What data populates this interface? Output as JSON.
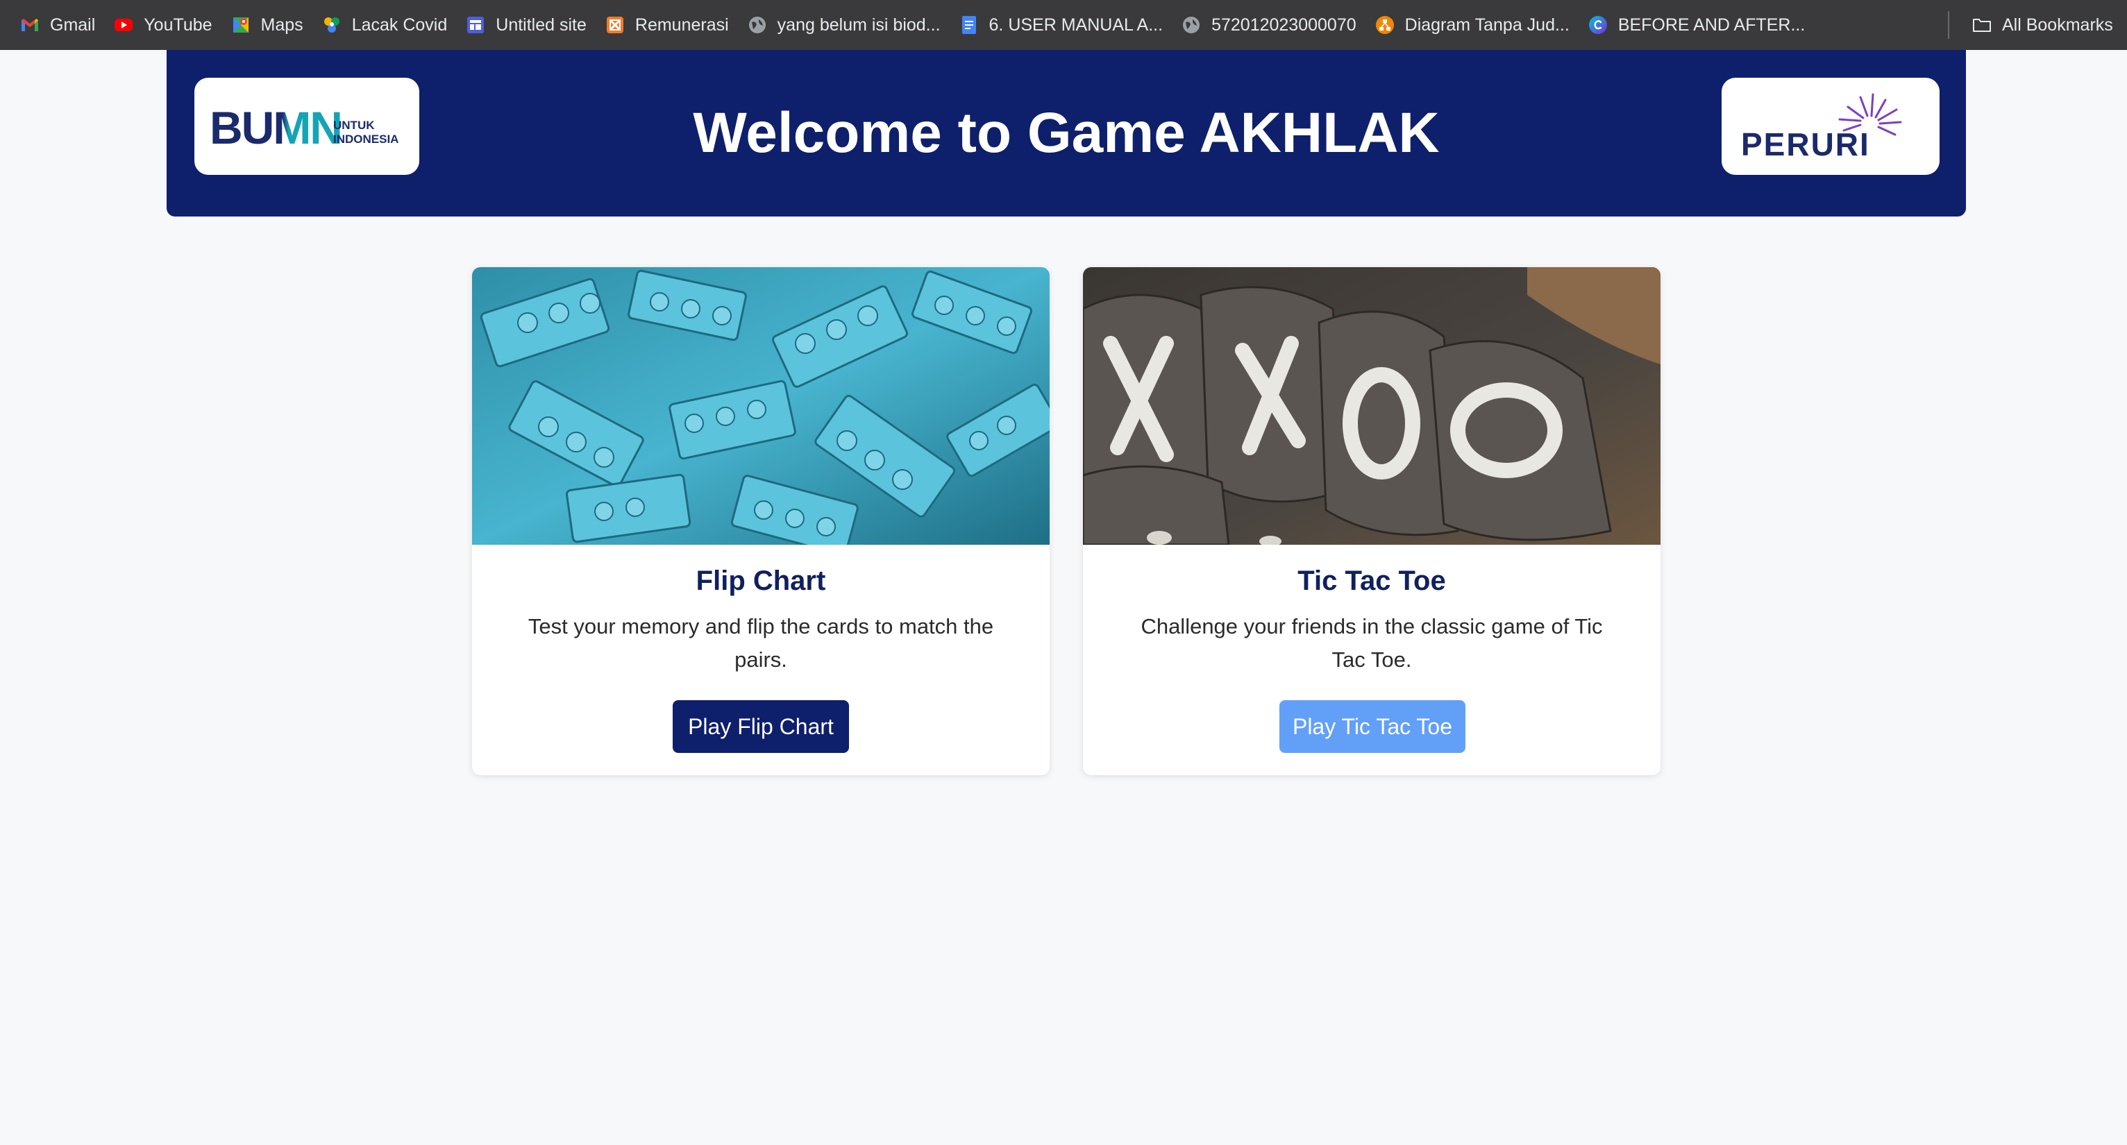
{
  "bookmarks": {
    "items": [
      {
        "label": "Gmail",
        "icon": "gmail-icon"
      },
      {
        "label": "YouTube",
        "icon": "youtube-icon"
      },
      {
        "label": "Maps",
        "icon": "maps-icon"
      },
      {
        "label": "Lacak Covid",
        "icon": "lacak-covid-icon"
      },
      {
        "label": "Untitled site",
        "icon": "google-sites-icon"
      },
      {
        "label": "Remunerasi",
        "icon": "remunerasi-icon"
      },
      {
        "label": "yang belum isi biod...",
        "icon": "globe-icon"
      },
      {
        "label": "6. USER MANUAL A...",
        "icon": "google-docs-icon"
      },
      {
        "label": "572012023000070",
        "icon": "globe-icon"
      },
      {
        "label": "Diagram Tanpa Jud...",
        "icon": "drawio-icon"
      },
      {
        "label": "BEFORE AND AFTER...",
        "icon": "canva-icon"
      }
    ],
    "all_bookmarks_label": "All Bookmarks"
  },
  "header": {
    "title": "Welcome to Game AKHLAK",
    "left_logo": {
      "name": "bumn-untuk-indonesia-logo",
      "text_main": "BUMN",
      "text_sub_1": "UNTUK",
      "text_sub_2": "INDONESIA"
    },
    "right_logo": {
      "name": "peruri-logo",
      "text": "PERURI"
    },
    "background_color": "#0e1f6b"
  },
  "games": [
    {
      "title": "Flip Chart",
      "description": "Test your memory and flip the cards to match the pairs.",
      "button_label": "Play Flip Chart",
      "image": "blue-lego-bricks-photo",
      "button_color": "#0e1f6b"
    },
    {
      "title": "Tic Tac Toe",
      "description": "Challenge your friends in the classic game of Tic Tac Toe.",
      "button_label": "Play Tic Tac Toe",
      "image": "tic-tac-toe-bean-bags-photo",
      "button_color": "#62a0f8"
    }
  ]
}
